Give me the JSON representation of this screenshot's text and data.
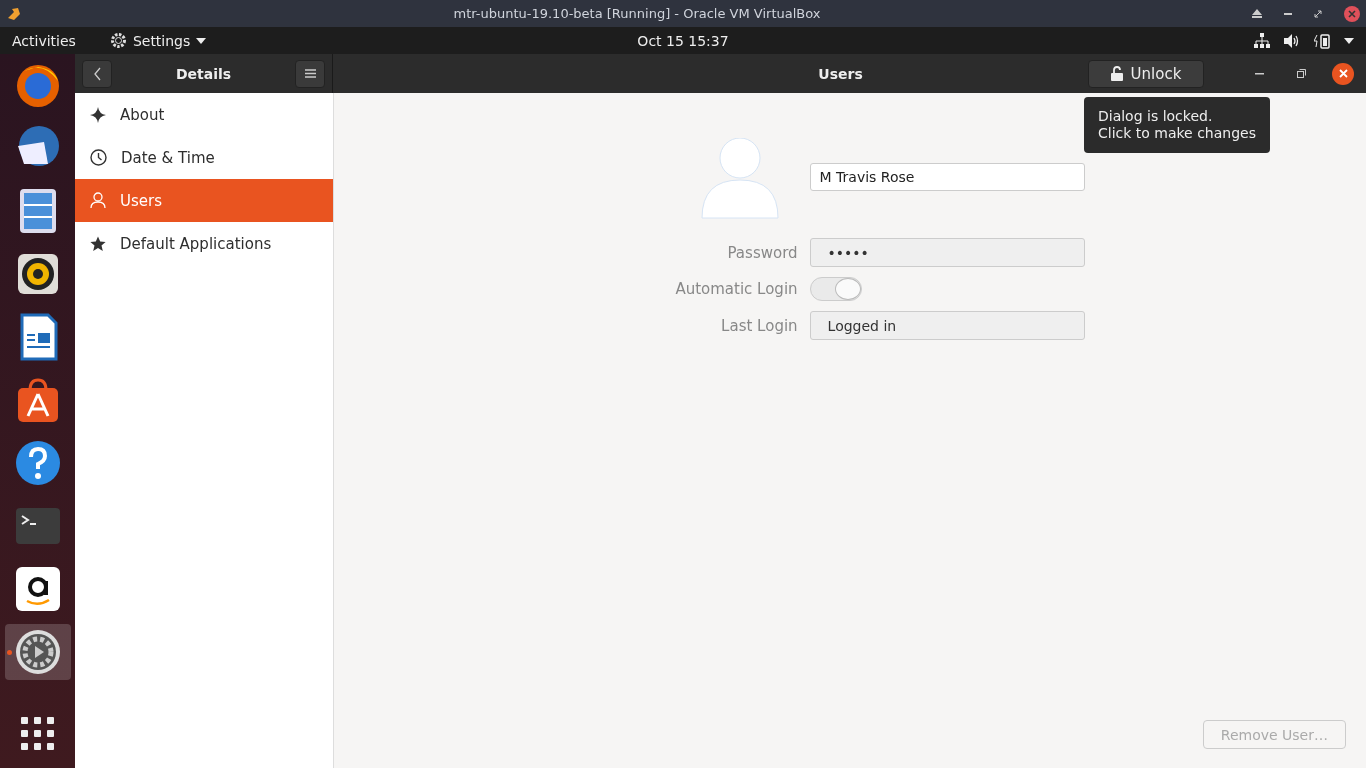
{
  "host_window": {
    "title": "mtr-ubuntu-19.10-beta [Running] - Oracle VM VirtualBox"
  },
  "top_bar": {
    "activities": "Activities",
    "app_menu": "Settings",
    "clock": "Oct 15  15:37"
  },
  "dock": [
    {
      "kind": "firefox",
      "selected": false,
      "running": false
    },
    {
      "kind": "thunderbird",
      "selected": false,
      "running": false
    },
    {
      "kind": "files",
      "selected": false,
      "running": false
    },
    {
      "kind": "rhythmbox",
      "selected": false,
      "running": false
    },
    {
      "kind": "writer",
      "selected": false,
      "running": false
    },
    {
      "kind": "software",
      "selected": false,
      "running": false
    },
    {
      "kind": "help",
      "selected": false,
      "running": false
    },
    {
      "kind": "terminal",
      "selected": false,
      "running": false
    },
    {
      "kind": "amazon",
      "selected": false,
      "running": false
    },
    {
      "kind": "settings",
      "selected": true,
      "running": true
    },
    {
      "kind": "apps",
      "selected": false,
      "running": false
    }
  ],
  "sidebar": {
    "title": "Details",
    "items": [
      {
        "label": "About",
        "selected": false
      },
      {
        "label": "Date & Time",
        "selected": false
      },
      {
        "label": "Users",
        "selected": true
      },
      {
        "label": "Default Applications",
        "selected": false
      }
    ]
  },
  "main": {
    "title": "Users",
    "unlock_button": "Unlock",
    "tooltip": "Dialog is locked.\nClick to make changes",
    "name": "M Travis Rose",
    "password": {
      "label": "Password",
      "value": "•••••"
    },
    "automatic_login": {
      "label": "Automatic Login",
      "on": true,
      "disabled": true
    },
    "last_login": {
      "label": "Last Login",
      "value": "Logged in"
    },
    "remove_button": {
      "label": "Remove User…",
      "disabled": true
    }
  }
}
